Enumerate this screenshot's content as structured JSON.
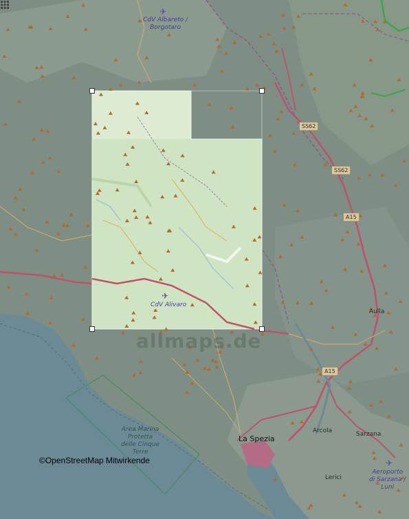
{
  "map": {
    "attribution": "©OpenStreetMap Mitwirkende",
    "watermark": "allmaps.de",
    "airports": [
      {
        "name_line1": "CdV Albareto /",
        "name_line2": "Borgotaro"
      },
      {
        "name_line1": "CdV Alivaro",
        "name_line2": ""
      },
      {
        "name_line1": "Aeroporto",
        "name_line2": "di Sarzana /"
      },
      {
        "name_line3": "Luni"
      }
    ],
    "places": {
      "la_spezia": "La Spezia",
      "aulla": "Aulla",
      "arcola": "Arcola",
      "sarzana": "Sarzana",
      "lerici": "Lerici"
    },
    "protected_area": {
      "line1": "Area Marina",
      "line2": "Protetta",
      "line3": "delle Cinque",
      "line4": "Terre"
    },
    "road_shields": [
      "SS62",
      "SS62",
      "A15",
      "A15"
    ],
    "colors": {
      "forest": "#7f8e84",
      "sea": "#6b8a96",
      "overlay": "#d6ecc8",
      "road_primary": "#c0506a",
      "peak": "#b5682e",
      "boundary": "#8a5a8a"
    },
    "overlay_tool": {
      "grid_icon": "grid-icon",
      "handles": [
        "handle-top-left",
        "handle-top-right",
        "handle-bottom-left",
        "handle-bottom-right"
      ]
    }
  }
}
